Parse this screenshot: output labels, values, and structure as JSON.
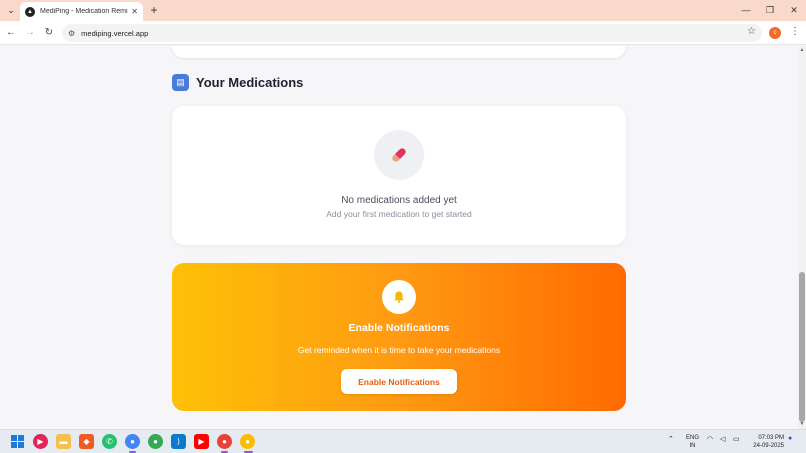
{
  "browser": {
    "tab_title": "MediPing - Medication Remind",
    "tab_close": "✕",
    "new_tab": "+",
    "url": "mediping.vercel.app",
    "profile_initial": "c",
    "window_controls": {
      "minimize": "—",
      "restore": "❐",
      "close": "✕"
    },
    "nav": {
      "back": "←",
      "forward": "→",
      "reload": "↻"
    }
  },
  "section": {
    "title": "Your Medications"
  },
  "medications": {
    "empty_title": "No medications added yet",
    "empty_subtitle": "Add your first medication to get started"
  },
  "notifications": {
    "title": "Enable Notifications",
    "subtitle": "Get reminded when it is time to take your medications",
    "button_label": "Enable Notifications"
  },
  "taskbar": {
    "language": "ENG",
    "region": "IN",
    "time": "07:03 PM",
    "date": "24-09-2025"
  },
  "colors": {
    "gradient_start": "#fec107",
    "gradient_end": "#ff6a00",
    "button_text": "#e85d0a",
    "section_icon": "#4a7bd8"
  },
  "icons": {
    "tab_favicon": "mediping-logo-icon",
    "section": "clipboard-icon",
    "empty_state": "pill-icon",
    "notification": "bell-icon"
  }
}
